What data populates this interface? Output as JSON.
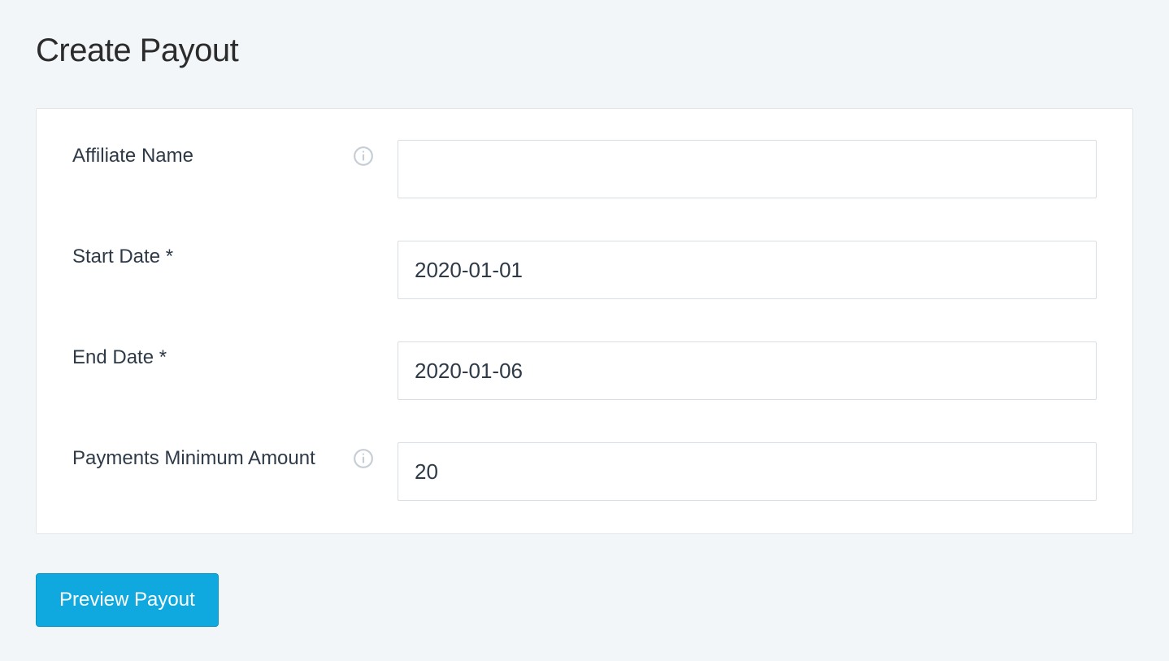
{
  "page": {
    "title": "Create Payout"
  },
  "form": {
    "affiliateName": {
      "label": "Affiliate Name",
      "value": "",
      "hasInfo": true
    },
    "startDate": {
      "label": "Start Date *",
      "value": "2020-01-01",
      "hasInfo": false
    },
    "endDate": {
      "label": "End Date *",
      "value": "2020-01-06",
      "hasInfo": false
    },
    "minAmount": {
      "label": "Payments Minimum Amount",
      "value": "20",
      "hasInfo": true
    }
  },
  "actions": {
    "previewLabel": "Preview Payout"
  }
}
